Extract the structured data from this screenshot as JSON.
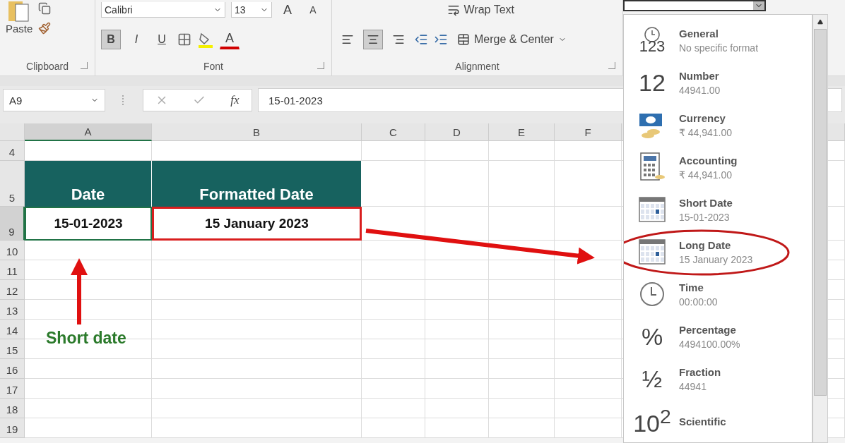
{
  "ribbon": {
    "clipboard": {
      "paste_label": "Paste",
      "group_label": "Clipboard"
    },
    "font": {
      "font_name": "Calibri",
      "font_size": "13",
      "grow_label": "A",
      "shrink_label": "A",
      "style_buttons": [
        {
          "label": "B",
          "selected": true
        },
        {
          "label": "I",
          "selected": false
        },
        {
          "label": "U",
          "selected": false
        }
      ],
      "font_color_label": "A",
      "group_label": "Font"
    },
    "alignment": {
      "wrap_text": "Wrap Text",
      "merge_center": "Merge & Center",
      "align_buttons": [
        {
          "kind": "left",
          "selected": false
        },
        {
          "kind": "center",
          "selected": true
        },
        {
          "kind": "right",
          "selected": false
        }
      ],
      "group_label": "Alignment"
    }
  },
  "formula_bar": {
    "name_box": "A9",
    "function_label": "fx",
    "value": "15-01-2023"
  },
  "sheet": {
    "columns": [
      {
        "label": "A",
        "selected": true
      },
      {
        "label": "B",
        "selected": false
      },
      {
        "label": "C",
        "selected": false
      },
      {
        "label": "D",
        "selected": false
      },
      {
        "label": "E",
        "selected": false
      },
      {
        "label": "F",
        "selected": false
      }
    ],
    "rows": [
      {
        "label": "4",
        "kind": "blank",
        "selected": false
      },
      {
        "label": "5",
        "kind": "header",
        "selected": false,
        "cells": [
          {
            "text": "Date"
          },
          {
            "text": "Formatted Date"
          }
        ]
      },
      {
        "label": "9",
        "kind": "data",
        "selected": true,
        "cells": [
          {
            "text": "15-01-2023",
            "selected": true,
            "outlined": false
          },
          {
            "text": "15 January 2023",
            "selected": false,
            "outlined": true
          }
        ]
      },
      {
        "label": "10",
        "kind": "blank",
        "selected": false
      },
      {
        "label": "11",
        "kind": "blank",
        "selected": false
      },
      {
        "label": "12",
        "kind": "blank",
        "selected": false
      },
      {
        "label": "13",
        "kind": "blank",
        "selected": false
      },
      {
        "label": "14",
        "kind": "blank",
        "selected": false
      },
      {
        "label": "15",
        "kind": "blank",
        "selected": false
      },
      {
        "label": "16",
        "kind": "blank",
        "selected": false
      },
      {
        "label": "17",
        "kind": "blank",
        "selected": false
      },
      {
        "label": "18",
        "kind": "blank",
        "selected": false
      },
      {
        "label": "19",
        "kind": "blank",
        "selected": false
      }
    ]
  },
  "annotation": {
    "note": "Short date"
  },
  "format_menu": {
    "items": [
      {
        "name": "General",
        "example": "No specific format",
        "kind": "general",
        "icon_text": "123",
        "circled": false
      },
      {
        "name": "Number",
        "example": "44941.00",
        "kind": "glyph",
        "icon_text": "12",
        "circled": false
      },
      {
        "name": "Currency",
        "example": "₹ 44,941.00",
        "kind": "currency",
        "circled": false
      },
      {
        "name": "Accounting",
        "example": " ₹ 44,941.00",
        "kind": "accounting",
        "circled": false
      },
      {
        "name": "Short Date",
        "example": "15-01-2023",
        "kind": "calendar",
        "circled": false
      },
      {
        "name": "Long Date",
        "example": "15 January 2023",
        "kind": "calendar",
        "circled": true
      },
      {
        "name": "Time",
        "example": "00:00:00",
        "kind": "clock",
        "circled": false
      },
      {
        "name": "Percentage",
        "example": "4494100.00%",
        "kind": "glyph",
        "icon_text": "%",
        "circled": false
      },
      {
        "name": "Fraction",
        "example": "44941",
        "kind": "glyph",
        "icon_text": "½",
        "circled": false
      },
      {
        "name": "Scientific",
        "kind": "glyph",
        "icon_text": "10$^{2}$",
        "circled": false
      }
    ]
  }
}
